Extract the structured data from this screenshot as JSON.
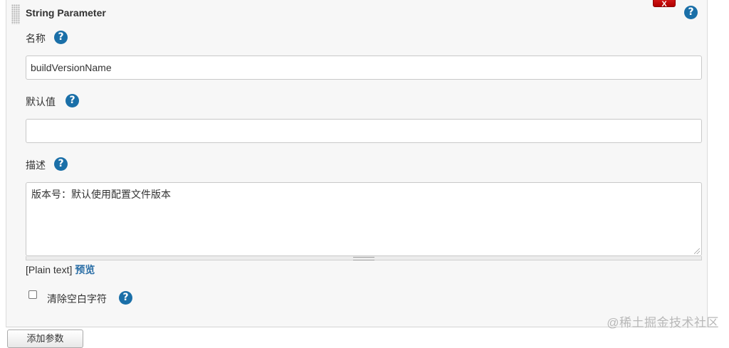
{
  "panel": {
    "title": "String Parameter",
    "delete_label": "X",
    "help_glyph": "?"
  },
  "fields": {
    "name": {
      "label": "名称",
      "value": "buildVersionName"
    },
    "default_value": {
      "label": "默认值",
      "value": ""
    },
    "description": {
      "label": "描述",
      "value": "版本号：默认使用配置文件版本"
    }
  },
  "plain_text": {
    "format_label": "[Plain text]",
    "preview_link": "预览"
  },
  "trim_option": {
    "label": "清除空白字符",
    "checked": false
  },
  "bottom_button": {
    "label": "添加参数"
  },
  "watermark": "@稀土掘金技术社区",
  "colors": {
    "help_icon": "#1a6fa8",
    "delete_button": "#d01010",
    "link": "#2a6ea6",
    "panel_bg": "#f7f7f7"
  },
  "icons": {
    "help": "help-circle-icon",
    "drag": "drag-handle-icon"
  }
}
